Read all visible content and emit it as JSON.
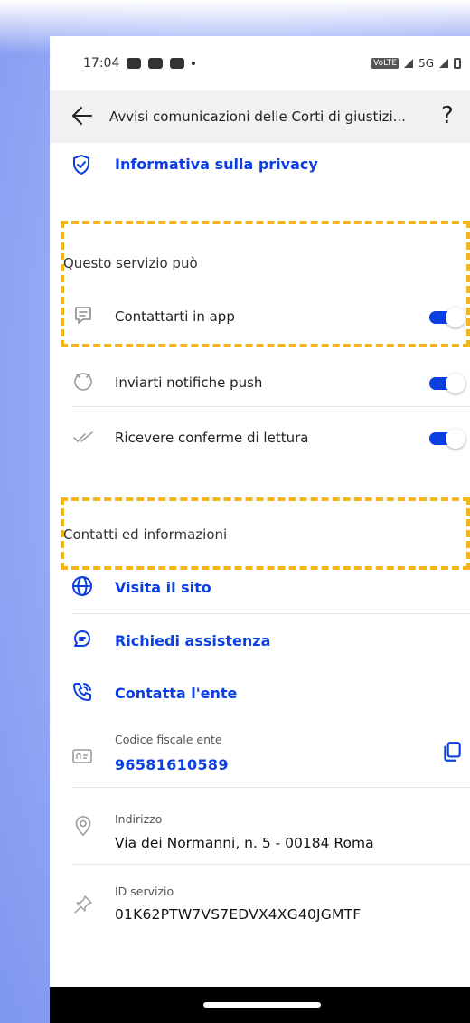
{
  "statusbar": {
    "time": "17:04",
    "network": "5G"
  },
  "header": {
    "title": "Avvisi comunicazioni delle Corti di giustizi..."
  },
  "privacy": {
    "label": "Informativa sulla privacy"
  },
  "permissions": {
    "title": "Questo servizio può",
    "items": [
      {
        "label": "Contattarti in app",
        "icon": "chat-icon",
        "enabled": true
      },
      {
        "label": "Inviarti notifiche push",
        "icon": "bell-icon",
        "enabled": true
      },
      {
        "label": "Ricevere conferme di lettura",
        "icon": "double-check-icon",
        "enabled": true
      }
    ]
  },
  "contacts": {
    "title": "Contatti ed informazioni",
    "links": [
      {
        "label": "Visita il sito",
        "icon": "globe-icon"
      },
      {
        "label": "Richiedi assistenza",
        "icon": "chat-help-icon"
      },
      {
        "label": "Contatta l'ente",
        "icon": "phone-icon"
      }
    ],
    "fiscal_code": {
      "label": "Codice fiscale ente",
      "value": "96581610589"
    },
    "address": {
      "label": "Indirizzo",
      "value": "Via dei Normanni, n. 5 - 00184 Roma"
    },
    "service_id": {
      "label": "ID servizio",
      "value": "01K62PTW7VS7EDVX4XG40JGMTF"
    }
  },
  "colors": {
    "accent": "#0b3ee3",
    "highlight": "#f3b51b"
  }
}
